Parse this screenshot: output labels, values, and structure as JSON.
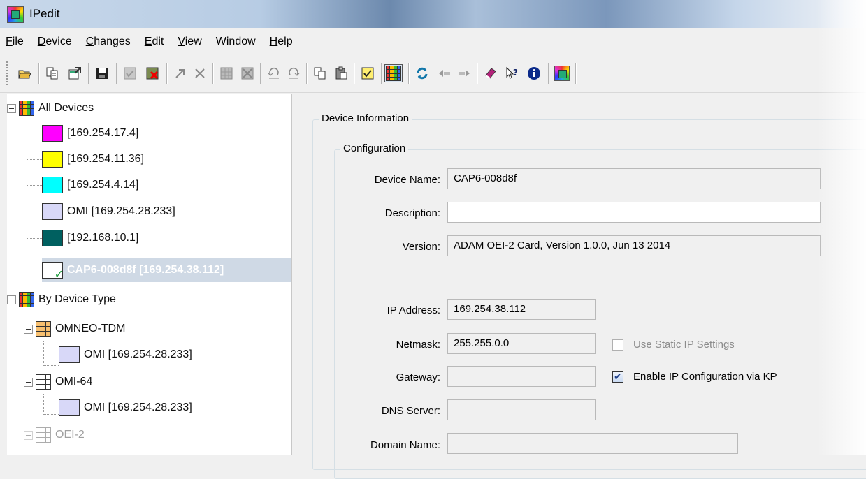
{
  "window": {
    "title": "IPedit"
  },
  "menu": [
    {
      "label": "File",
      "ul": "F",
      "rest": "ile"
    },
    {
      "label": "Device",
      "ul": "D",
      "rest": "evice"
    },
    {
      "label": "Changes",
      "ul": "C",
      "rest": "hanges"
    },
    {
      "label": "Edit",
      "ul": "E",
      "rest": "dit"
    },
    {
      "label": "View",
      "ul": "V",
      "rest": "iew"
    },
    {
      "label": "Window",
      "ul": "",
      "rest": "Window"
    },
    {
      "label": "Help",
      "ul": "H",
      "rest": "elp"
    }
  ],
  "tree": {
    "all_devices": "All Devices",
    "devices": [
      {
        "label": "[169.254.17.4]",
        "color": "#ff00ff"
      },
      {
        "label": "[169.254.11.36]",
        "color": "#ffff00"
      },
      {
        "label": "[169.254.4.14]",
        "color": "#00ffff"
      },
      {
        "label": "OMI [169.254.28.233]",
        "color": "#d8d8f8"
      },
      {
        "label": "[192.168.10.1]",
        "color": "#006060"
      },
      {
        "label": "CAP6-008d8f [169.254.38.112]",
        "color": "#ffffff"
      }
    ],
    "by_device_type": "By Device Type",
    "omneo_tdm": "OMNEO-TDM",
    "omneo_tdm_child": "OMI [169.254.28.233]",
    "omi64": "OMI-64",
    "omi64_child": "OMI [169.254.28.233]",
    "oei2": "OEI-2"
  },
  "panel": {
    "device_information": "Device Information",
    "configuration": "Configuration",
    "device_name_label": "Device Name:",
    "device_name": "CAP6-008d8f",
    "description_label": "Description:",
    "description": "",
    "version_label": "Version:",
    "version": "ADAM OEI-2 Card, Version 1.0.0, Jun 13 2014",
    "ip_label": "IP Address:",
    "ip": "169.254.38.112",
    "netmask_label": "Netmask:",
    "netmask": "255.255.0.0",
    "gateway_label": "Gateway:",
    "gateway": "",
    "dns_label": "DNS Server:",
    "dns": "",
    "domain_label": "Domain Name:",
    "domain": "",
    "static_ip_label": "Use Static IP Settings",
    "static_ip_checked": false,
    "kp_label": "Enable IP Configuration via KP",
    "kp_checked": true
  }
}
